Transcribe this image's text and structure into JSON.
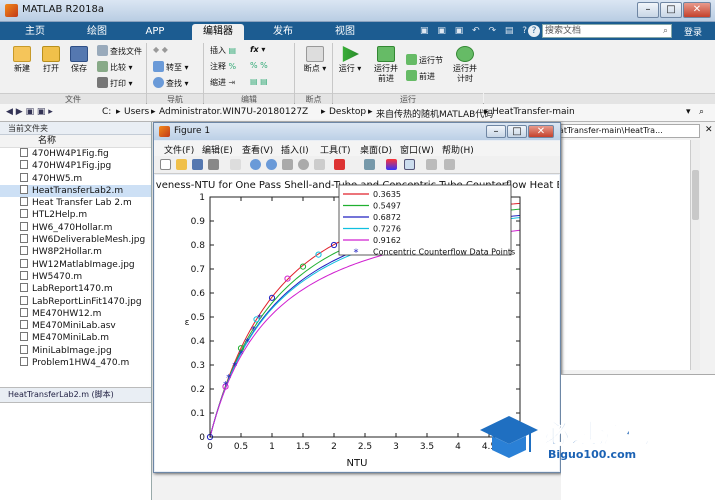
{
  "app": {
    "title": "MATLAB R2018a"
  },
  "tabs": [
    "主页",
    "绘图",
    "APP",
    "编辑器",
    "发布",
    "视图"
  ],
  "search": {
    "placeholder": "搜索文档",
    "login": "登录"
  },
  "ribbon": {
    "new": "新建",
    "open": "打开",
    "save": "保存",
    "find_files": "查找文件",
    "compare": "比较",
    "print": "打印",
    "goto": "转至",
    "find": "查找",
    "insert": "插入",
    "comment": "注释",
    "indent": "缩进",
    "breakpoints": "断点",
    "run": "运行",
    "run_advance": "运行并\n前进",
    "run_section": "运行节",
    "advance": "前进",
    "run_time": "运行并\n计时",
    "groups": [
      "文件",
      "导航",
      "编辑",
      "断点",
      "运行"
    ]
  },
  "address": {
    "path": [
      "C:",
      "Users",
      "Administrator.WIN7U-20180127Z",
      "Desktop",
      "来自传热的随机MATLAB代码",
      "HeatTransfer-main"
    ]
  },
  "current_folder": {
    "label": "当前文件夹",
    "column": "名称",
    "files": [
      "470HW4P1Fig.fig",
      "470HW4P1Fig.jpg",
      "470HW5.m",
      "HeatTransferLab2.m",
      "Heat Transfer Lab 2.m",
      "HTL2Help.m",
      "HW6_470Hollar.m",
      "HW6DeliverableMesh.jpg",
      "HW8P2Hollar.m",
      "HW12MatlabImage.jpg",
      "HW5470.m",
      "LabReport1470.m",
      "LabReportLinFit1470.jpg",
      "ME470HW12.m",
      "ME470MiniLab.asv",
      "ME470MiniLab.m",
      "MiniLabImage.jpg",
      "Problem1HW4_470.m"
    ],
    "selected": "HeatTransferLab2.m",
    "details": "HeatTransferLab2.m  (脚本)"
  },
  "editor_tab": "eatTransfer-main\\HeatTra...",
  "figure": {
    "title": "Figure 1",
    "menu": [
      "文件(F)",
      "编辑(E)",
      "查看(V)",
      "插入(I)",
      "工具(T)",
      "桌面(D)",
      "窗口(W)",
      "帮助(H)"
    ]
  },
  "chart_data": {
    "type": "line",
    "title": "iveness-NTU for One Pass Shell-and-Tube and Concentric Tube Counterflow Heat Exc",
    "xlabel": "NTU",
    "ylabel": "ε",
    "xlim": [
      0,
      5
    ],
    "ylim": [
      0,
      1
    ],
    "xticks": [
      0,
      0.5,
      1,
      1.5,
      2,
      2.5,
      3,
      3.5,
      4,
      4.5
    ],
    "yticks": [
      0,
      0.1,
      0.2,
      0.3,
      0.4,
      0.5,
      0.6,
      0.7,
      0.8,
      0.9,
      1
    ],
    "legend_position": "top-right",
    "series": [
      {
        "name": "0.3635",
        "color": "#e0202a"
      },
      {
        "name": "0.5497",
        "color": "#20b030"
      },
      {
        "name": "0.6872",
        "color": "#2020c0"
      },
      {
        "name": "0.7276",
        "color": "#10c0e0"
      },
      {
        "name": "0.9162",
        "color": "#d020d0"
      }
    ],
    "points_label": "Concentric Counterflow Data Points",
    "circle_points": [
      [
        0,
        0
      ],
      [
        0.25,
        0.21
      ],
      [
        0.5,
        0.37
      ],
      [
        0.75,
        0.49
      ],
      [
        1,
        0.58
      ],
      [
        1.25,
        0.66
      ],
      [
        1.5,
        0.71
      ],
      [
        1.75,
        0.76
      ],
      [
        2,
        0.8
      ],
      [
        2.5,
        0.85
      ],
      [
        4.75,
        0.97
      ]
    ],
    "star_points": [
      [
        0.25,
        0.22
      ],
      [
        0.3,
        0.25
      ],
      [
        0.4,
        0.3
      ],
      [
        0.5,
        0.35
      ],
      [
        0.6,
        0.4
      ],
      [
        0.7,
        0.45
      ],
      [
        0.8,
        0.5
      ]
    ]
  },
  "watermark": {
    "brand": "必过源码",
    "url": "Biguo100.com"
  }
}
